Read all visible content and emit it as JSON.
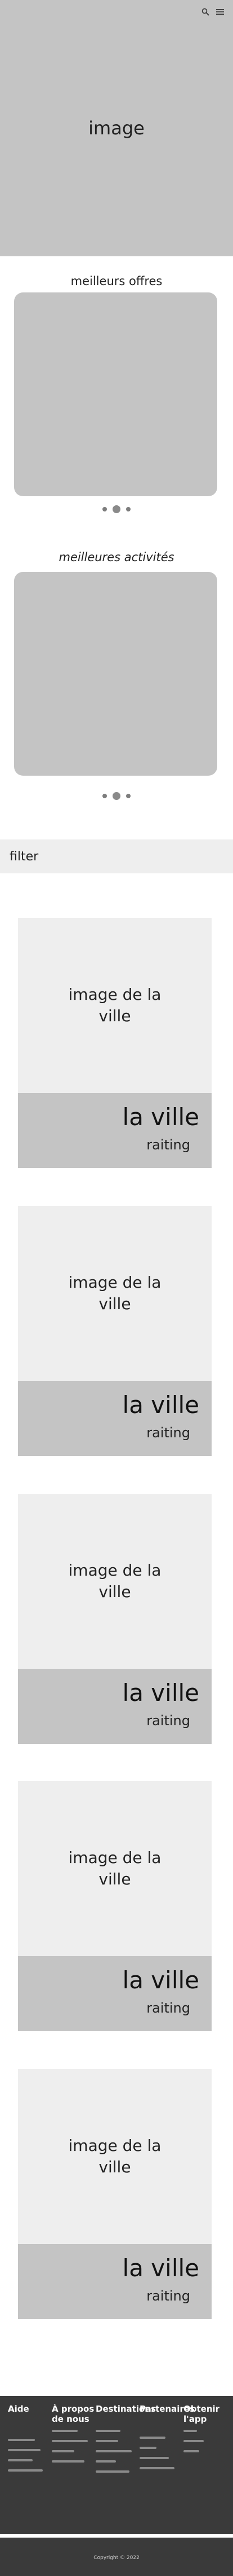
{
  "hero": {
    "image_label": "image",
    "icons": [
      "search-icon",
      "menu-icon"
    ]
  },
  "offers": {
    "title": "meilleurs offres"
  },
  "activities": {
    "title": "meilleures activités"
  },
  "filter": {
    "label": "filter"
  },
  "cities": [
    {
      "image_label": "image de la ville",
      "name": "la ville",
      "rating": "raiting"
    },
    {
      "image_label": "image de la ville",
      "name": "la ville",
      "rating": "raiting"
    },
    {
      "image_label": "image de la ville",
      "name": "la ville",
      "rating": "raiting"
    },
    {
      "image_label": "image de la ville",
      "name": "la ville",
      "rating": "raiting"
    },
    {
      "image_label": "image de la ville",
      "name": "la ville",
      "rating": "raiting"
    }
  ],
  "footer": {
    "columns": [
      {
        "title": "Aide"
      },
      {
        "title": "À propos de nous"
      },
      {
        "title": "Destinations"
      },
      {
        "title": "Partenaires"
      },
      {
        "title": "Obtenir l'app"
      }
    ],
    "copyright": "Copyright © 2022"
  },
  "colors": {
    "placeholder_gray": "#c4c4c4",
    "light_gray": "#eeeeee",
    "footer_bg": "#3a3a3a"
  }
}
